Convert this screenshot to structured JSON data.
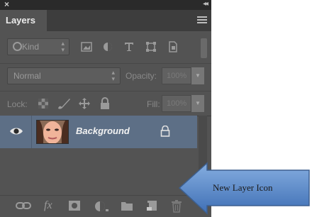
{
  "window": {
    "close_glyph": "×",
    "collapse_glyph": "◂◂"
  },
  "panel": {
    "tab_label": "Layers"
  },
  "filter": {
    "kind_label": "Kind",
    "icons": [
      "pixel-layer-filter-icon",
      "adjustment-layer-filter-icon",
      "type-layer-filter-icon",
      "shape-layer-filter-icon",
      "smart-object-filter-icon"
    ]
  },
  "blend": {
    "mode": "Normal",
    "opacity_label": "Opacity:",
    "opacity_value": "100%"
  },
  "lock": {
    "label": "Lock:",
    "fill_label": "Fill:",
    "fill_value": "100%"
  },
  "layers": [
    {
      "name": "Background",
      "visible": true,
      "locked": true
    }
  ],
  "bottom_icons": [
    "link-layers-icon",
    "fx-icon",
    "add-mask-icon",
    "adjustment-layer-icon",
    "new-group-icon",
    "new-layer-icon",
    "delete-layer-icon"
  ],
  "annotation": {
    "label": "New Layer Icon",
    "color": "#4f7fbf"
  },
  "colors": {
    "panel_bg": "#535353",
    "selected_row": "#5d6f86"
  }
}
